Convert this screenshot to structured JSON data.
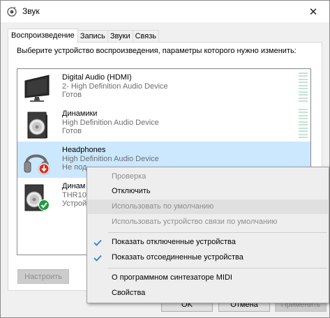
{
  "window": {
    "title": "Звук",
    "close_glyph": "✕"
  },
  "tabs": [
    {
      "label": "Воспроизведение",
      "active": true
    },
    {
      "label": "Запись",
      "active": false
    },
    {
      "label": "Звуки",
      "active": false
    },
    {
      "label": "Связь",
      "active": false
    }
  ],
  "panel": {
    "instruction": "Выберите устройство воспроизведения, параметры которого нужно изменить:"
  },
  "devices": [
    {
      "name": "Digital Audio (HDMI)",
      "driver": "2- High Definition Audio Device",
      "status": "Готов",
      "icon": "monitor-icon"
    },
    {
      "name": "Динамики",
      "driver": "High Definition Audio Device",
      "status": "Готов",
      "icon": "speaker-icon"
    },
    {
      "name": "Headphones",
      "driver": "High Definition Audio Device",
      "status": "Не под",
      "icon": "headphones-icon",
      "badge": "unplugged-badge"
    },
    {
      "name": "Динам",
      "driver": "THR10",
      "status": "Устрой",
      "icon": "speaker-icon",
      "badge": "default-check-badge"
    }
  ],
  "buttons": {
    "configure": "Настроить",
    "ok": "OK",
    "cancel": "Отмена",
    "apply": "Применить"
  },
  "context_menu": {
    "items": [
      {
        "label": "Проверка",
        "disabled": true
      },
      {
        "label": "Отключить",
        "disabled": false
      },
      {
        "label": "Использовать по умолчанию",
        "disabled": true
      },
      {
        "label": "Использовать устройство связи по умолчанию",
        "disabled": true
      },
      {
        "label": "Показать отключенные устройства",
        "checked": true
      },
      {
        "label": "Показать отсоединенные устройства",
        "checked": true
      },
      {
        "label": "О программном синтезаторе MIDI",
        "disabled": false
      },
      {
        "label": "Свойства",
        "disabled": false
      }
    ]
  },
  "colors": {
    "selection": "#cce8ff",
    "check": "#2f7fd8",
    "green_badge": "#1e9e3a",
    "red_badge": "#d62d20",
    "meter": "#c4e4d2"
  }
}
